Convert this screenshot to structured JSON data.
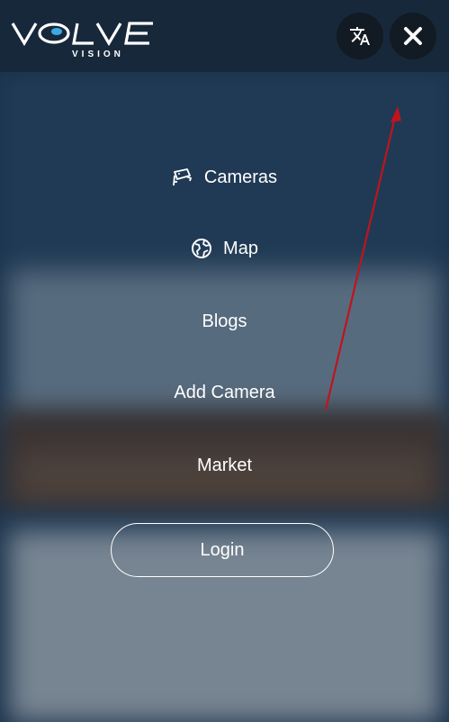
{
  "brand": {
    "name": "VOLVE",
    "tagline": "VISION"
  },
  "header": {
    "translate_icon": "translate-icon",
    "close_icon": "close-icon"
  },
  "menu": {
    "items": [
      {
        "label": "Cameras",
        "icon": "cctv-camera-icon"
      },
      {
        "label": "Map",
        "icon": "globe-icon"
      },
      {
        "label": "Blogs"
      },
      {
        "label": "Add Camera"
      },
      {
        "label": "Market"
      }
    ],
    "login_label": "Login"
  },
  "colors": {
    "header_bg": "#17283a",
    "button_bg": "#121a24",
    "text": "#ffffff",
    "logo_accent": "#3aa9e6",
    "annotation_arrow": "#c0141c"
  }
}
